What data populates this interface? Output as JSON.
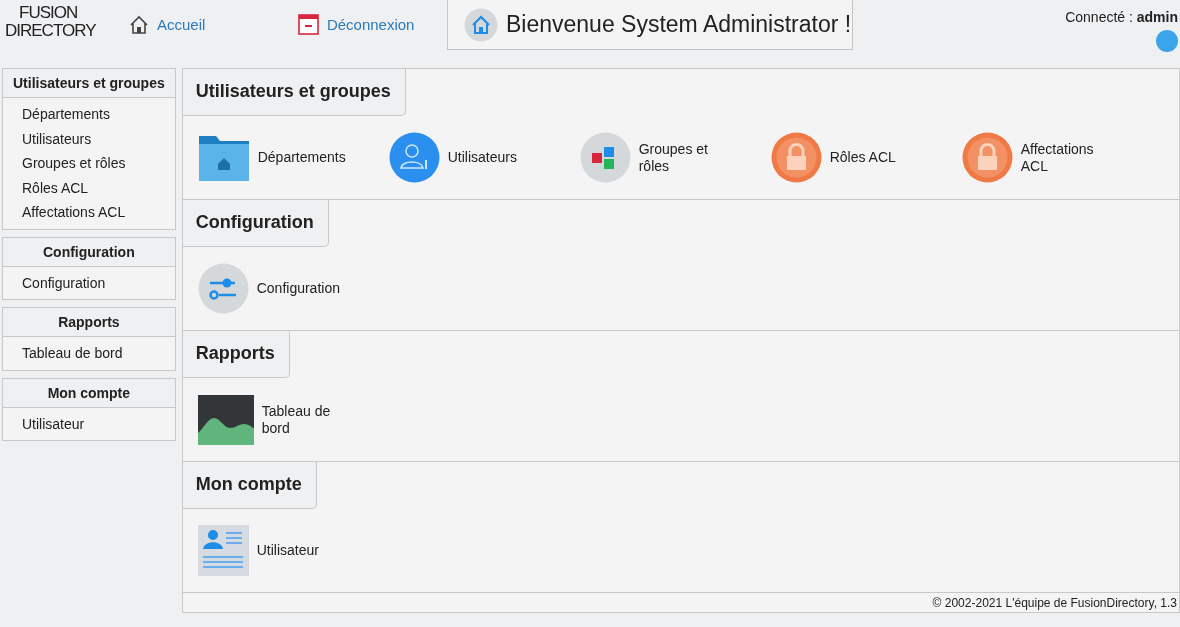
{
  "header": {
    "logo": {
      "line1": "FUSION",
      "line2": "DIRECTORY"
    },
    "links": [
      {
        "kind": "home",
        "label": "Accueil"
      },
      {
        "kind": "logout",
        "label": "Déconnexion"
      }
    ],
    "welcome": "Bienvenue System Administrator !",
    "connected_label": "Connecté :",
    "connected_user": "admin"
  },
  "sidebar": [
    {
      "title": "Utilisateurs et groupes",
      "items": [
        "Départements",
        "Utilisateurs",
        "Groupes et rôles",
        "Rôles ACL",
        "Affectations ACL"
      ]
    },
    {
      "title": "Configuration",
      "items": [
        "Configuration"
      ]
    },
    {
      "title": "Rapports",
      "items": [
        "Tableau de bord"
      ]
    },
    {
      "title": "Mon compte",
      "items": [
        "Utilisateur"
      ]
    }
  ],
  "sections": [
    {
      "title": "Utilisateurs et groupes",
      "items": [
        {
          "kind": "folder",
          "label": "Départements"
        },
        {
          "kind": "user",
          "label": "Utilisateurs"
        },
        {
          "kind": "groups",
          "label": "Groupes et rôles"
        },
        {
          "kind": "lock",
          "label": "Rôles ACL"
        },
        {
          "kind": "lock",
          "label": "Affectations ACL"
        }
      ]
    },
    {
      "title": "Configuration",
      "items": [
        {
          "kind": "settings",
          "label": "Configuration"
        }
      ]
    },
    {
      "title": "Rapports",
      "items": [
        {
          "kind": "chart",
          "label": "Tableau de bord"
        }
      ]
    },
    {
      "title": "Mon compte",
      "items": [
        {
          "kind": "card",
          "label": "Utilisateur"
        }
      ]
    }
  ],
  "footer": "© 2002-2021 L'équipe de FusionDirectory, 1.3"
}
